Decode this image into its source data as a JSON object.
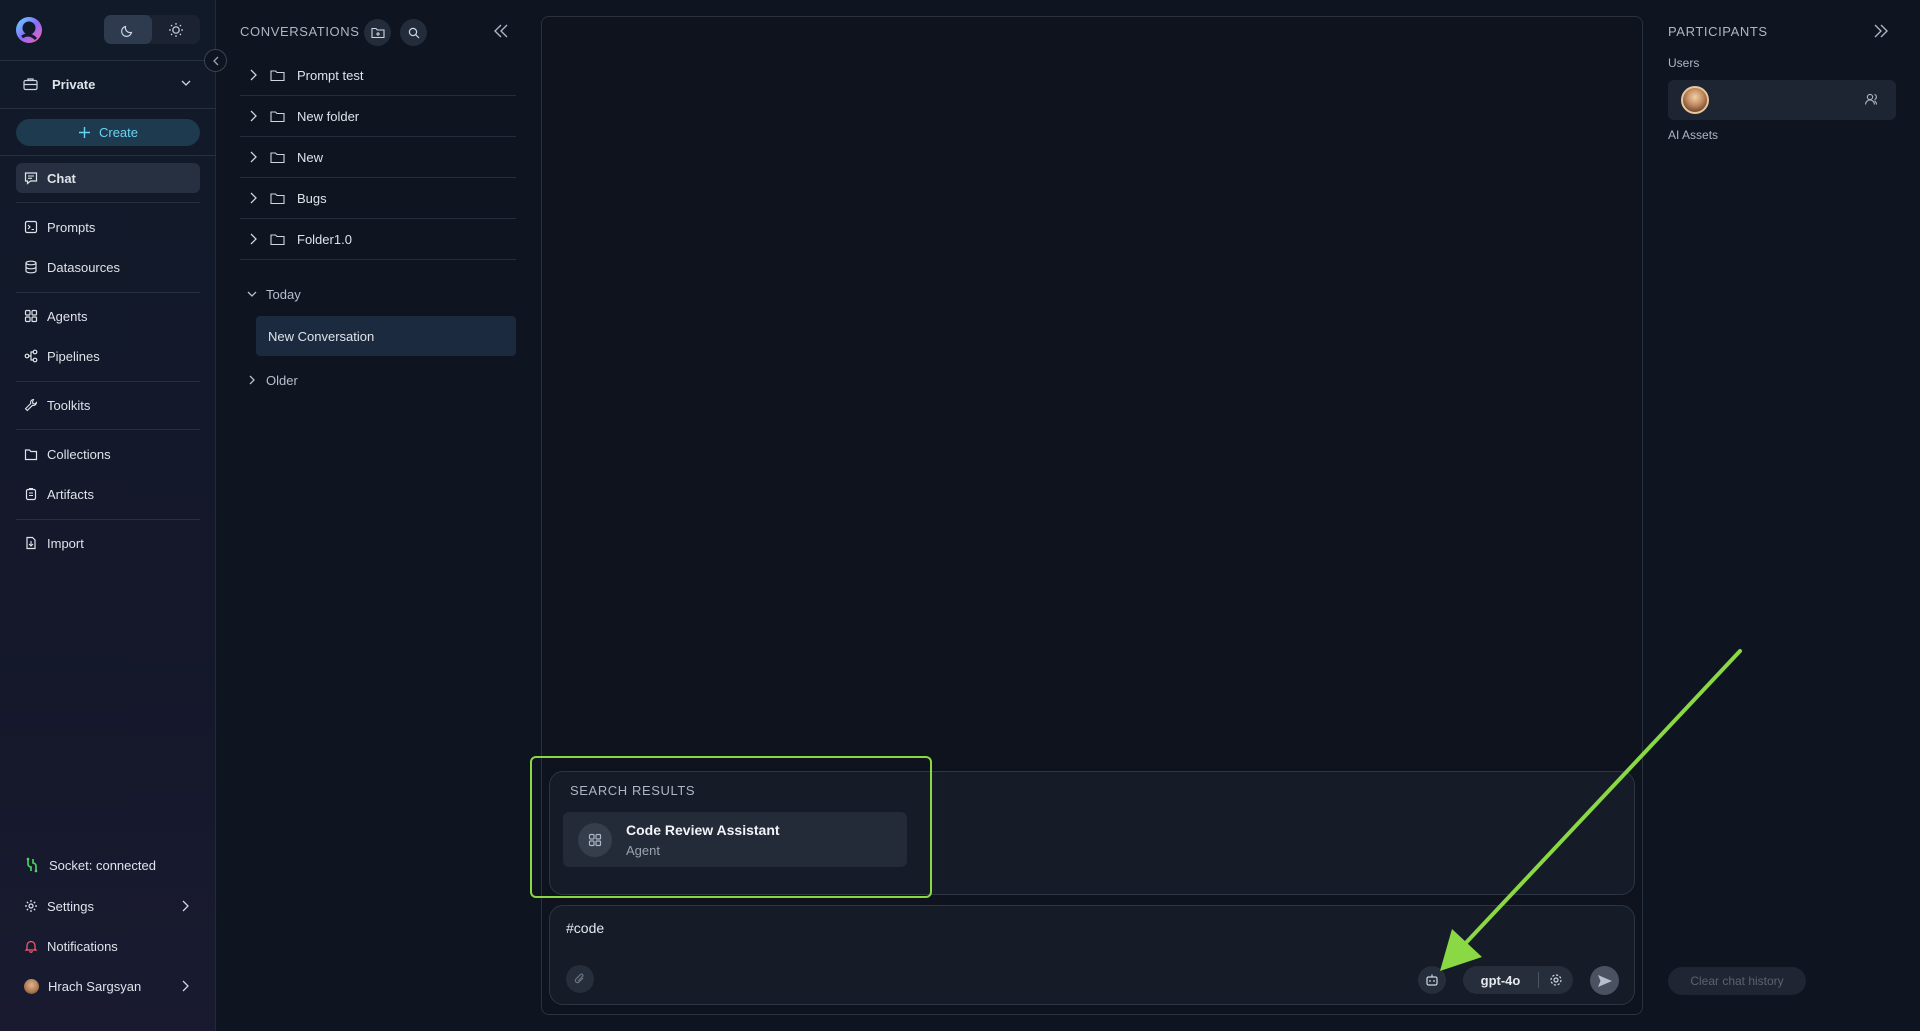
{
  "app": {
    "logo_icon": "elitea-logo-icon"
  },
  "theme": {
    "dark_icon": "moon-icon",
    "light_icon": "sun-icon"
  },
  "sidebar": {
    "workspace_label": "Private",
    "create_label": "Create",
    "items": [
      {
        "label": "Chat",
        "icon": "chat-icon",
        "active": true
      },
      {
        "label": "Prompts",
        "icon": "prompt-icon"
      },
      {
        "label": "Datasources",
        "icon": "database-icon"
      },
      {
        "label": "Agents",
        "icon": "agents-icon"
      },
      {
        "label": "Pipelines",
        "icon": "pipelines-icon"
      },
      {
        "label": "Toolkits",
        "icon": "toolkits-icon"
      },
      {
        "label": "Collections",
        "icon": "folder-icon"
      },
      {
        "label": "Artifacts",
        "icon": "artifacts-icon"
      },
      {
        "label": "Import",
        "icon": "import-icon"
      }
    ],
    "footer": {
      "socket_status": "Socket: connected",
      "settings_label": "Settings",
      "notifications_label": "Notifications",
      "user_name": "Hrach Sargsyan"
    }
  },
  "conversations": {
    "title": "CONVERSATIONS",
    "folders": [
      "Prompt test",
      "New folder",
      "New",
      "Bugs",
      "Folder1.0"
    ],
    "groups": [
      {
        "label": "Today",
        "expanded": true,
        "items": [
          "New Conversation"
        ]
      },
      {
        "label": "Older",
        "expanded": false,
        "items": []
      }
    ]
  },
  "chat": {
    "search_results_label": "SEARCH RESULTS",
    "results": [
      {
        "name": "Code Review Assistant",
        "type": "Agent"
      }
    ],
    "input_value": "#code",
    "model": "gpt-4o"
  },
  "participants": {
    "title": "PARTICIPANTS",
    "users_label": "Users",
    "ai_assets_label": "AI Assets",
    "clear_history_label": "Clear chat history"
  },
  "colors": {
    "accent": "#6ad3f5",
    "highlight": "#8ad843",
    "background": "#0e1420"
  }
}
